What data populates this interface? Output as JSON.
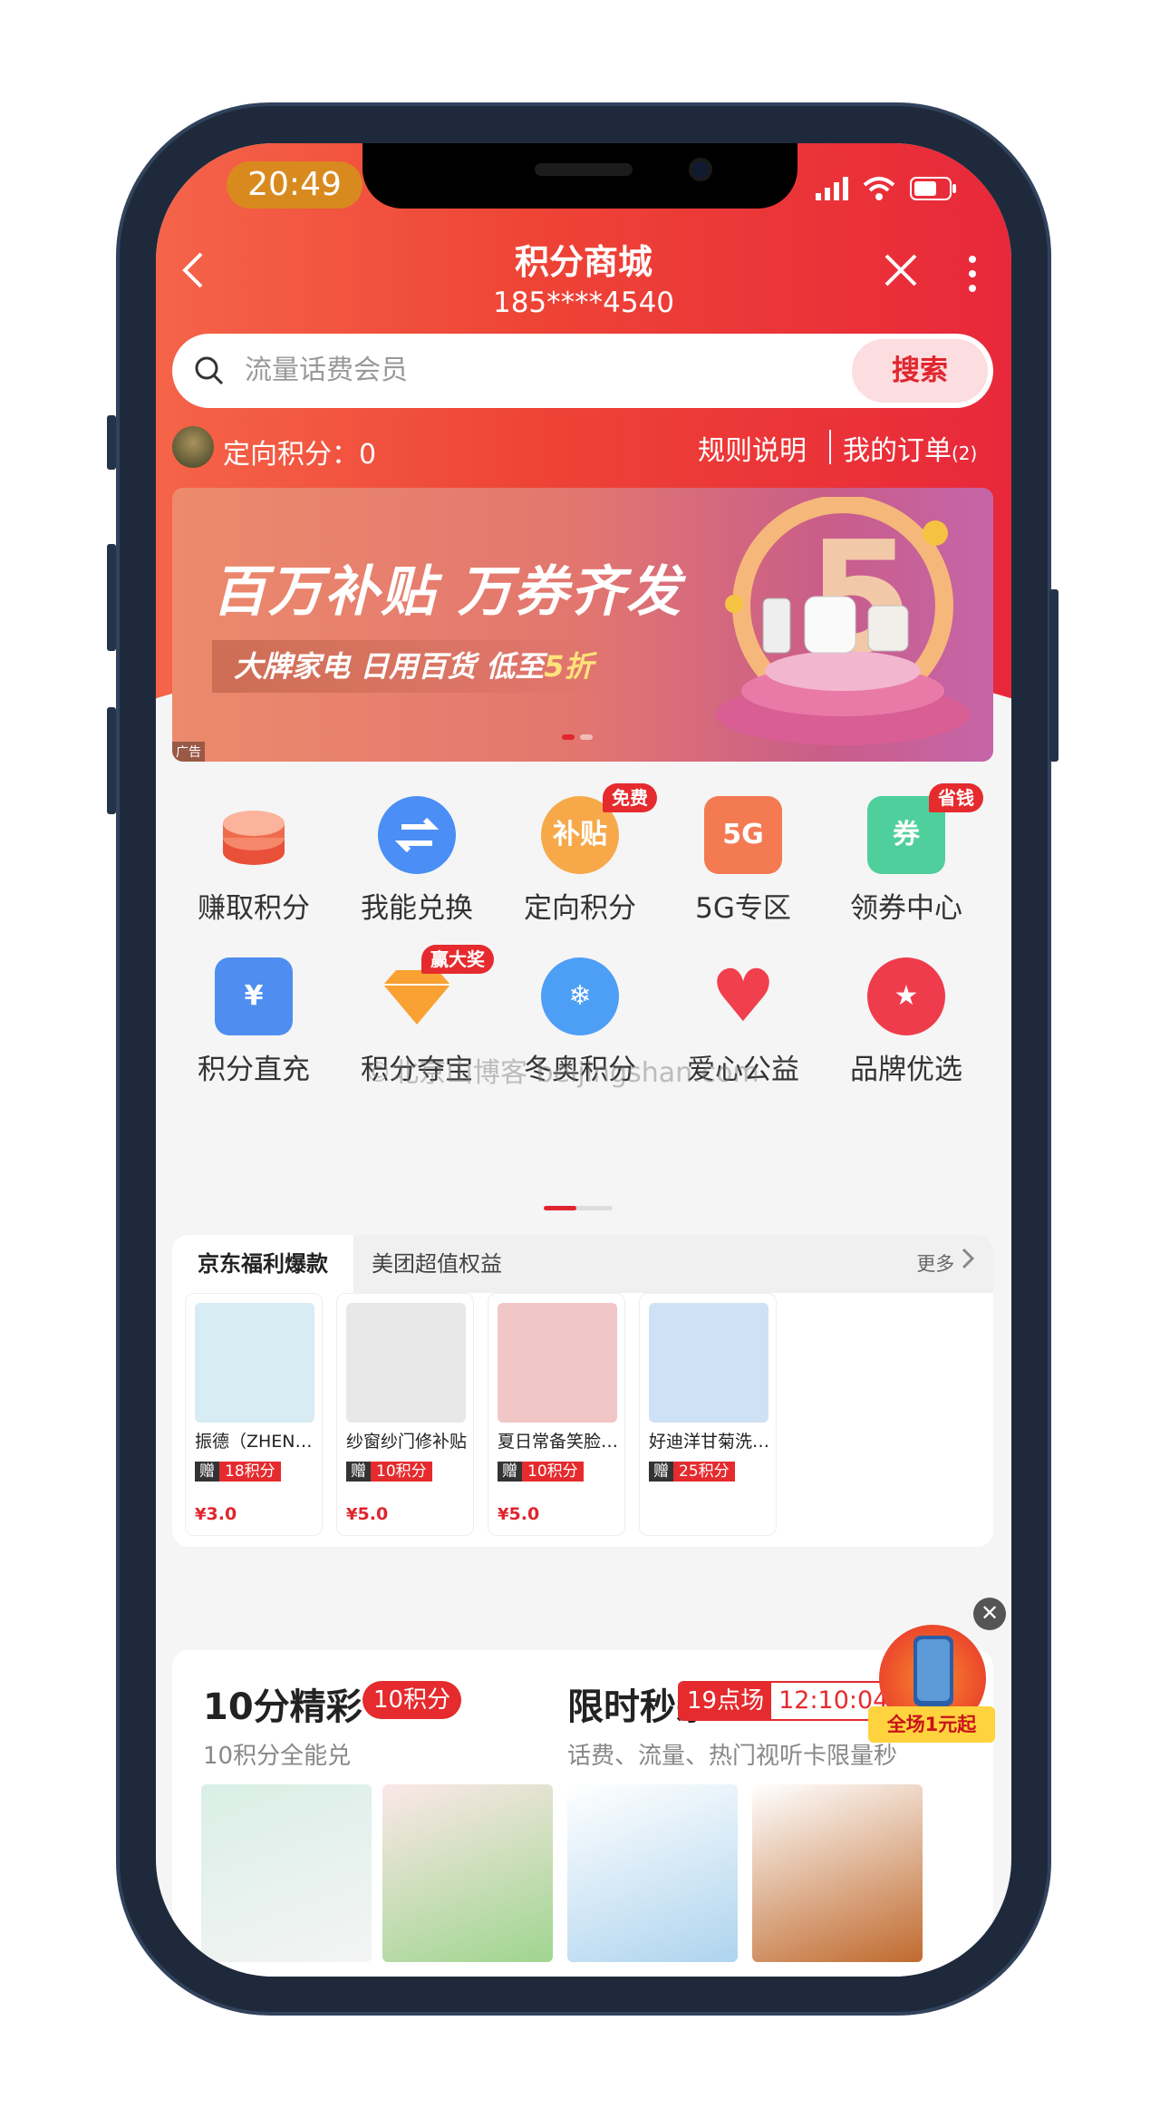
{
  "status_bar": {
    "time": "20:49"
  },
  "header": {
    "title": "积分商城",
    "phone": "185****4540"
  },
  "search": {
    "placeholder": "流量话费会员",
    "button": "搜索"
  },
  "points_bar": {
    "label": "定向积分：0",
    "rules": "规则说明",
    "orders_label": "我的订单",
    "orders_count": "(2)"
  },
  "banner": {
    "headline": "百万补贴  万券齐发",
    "sub_a": "大牌家电 日用百货 低至",
    "sub_b": "5折",
    "ad_tag": "广告"
  },
  "icons": [
    {
      "label": "赚取积分",
      "icon": "coins-stack-icon",
      "color": "#f06b4d"
    },
    {
      "label": "我能兑换",
      "icon": "exchange-icon",
      "color": "#4b8ef5"
    },
    {
      "label": "定向积分",
      "icon": "subsidy-bag-icon",
      "color": "#f7a94a",
      "badge": "免费",
      "glyph": "补贴"
    },
    {
      "label": "5G专区",
      "icon": "5g-phone-icon",
      "color": "#f47a52",
      "glyph": "5G"
    },
    {
      "label": "领券中心",
      "icon": "coupon-icon",
      "color": "#4fcf9b",
      "badge": "省钱",
      "glyph": "券"
    },
    {
      "label": "积分直充",
      "icon": "recharge-phone-icon",
      "color": "#4f8ef0",
      "glyph": "¥"
    },
    {
      "label": "积分夺宝",
      "icon": "diamond-icon",
      "color": "#f9a132",
      "badge": "赢大奖"
    },
    {
      "label": "冬奥积分",
      "icon": "snowflake-icon",
      "color": "#4d9ef5",
      "glyph": "❄"
    },
    {
      "label": "爱心公益",
      "icon": "heart-icon",
      "color": "#f0404d",
      "glyph": "♥"
    },
    {
      "label": "品牌优选",
      "icon": "star-badge-icon",
      "color": "#ef3c4c",
      "glyph": "★"
    }
  ],
  "watermark": "©北京山博客 beijingshan.com",
  "tabs": {
    "active": "京东福利爆款",
    "second": "美团超值权益",
    "more": "更多"
  },
  "products": [
    {
      "name": "振德（ZHENDE）医用口罩",
      "gift": "赠",
      "points": "18积分",
      "yen": "¥",
      "price": "3.0",
      "img_color": "#d7ecf3"
    },
    {
      "name": "纱窗纱门修补贴",
      "gift": "赠",
      "points": "10积分",
      "yen": "¥",
      "price": "5.0",
      "img_color": "#e8e8e8"
    },
    {
      "name": "夏日常备笑脸驱蚊贴",
      "gift": "赠",
      "points": "10积分",
      "yen": "¥",
      "price": "5.0",
      "img_color": "#f1c6c6"
    },
    {
      "name": "好迪洋甘菊洗手液",
      "gift": "赠",
      "points": "25积分",
      "yen": "¥",
      "price": "",
      "img_color": "#cfe2f5"
    }
  ],
  "float_promo": {
    "text": "全场1元起",
    "close": "✕"
  },
  "section2": {
    "left_title": "10分精彩",
    "left_pill": "10积分",
    "left_sub": "10积分全能兑",
    "right_title": "限时秒杀",
    "right_session": "19点场",
    "right_timer": "12:10:04",
    "right_sub": "话费、流量、热门视听卡限量秒"
  }
}
